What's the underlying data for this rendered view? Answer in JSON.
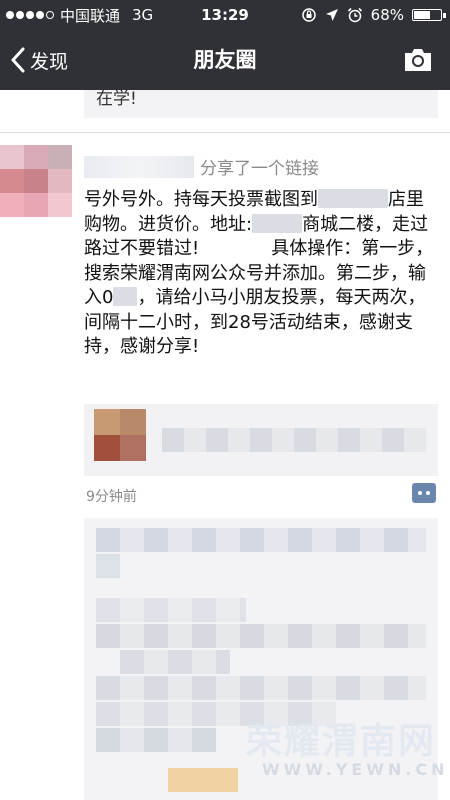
{
  "status_bar": {
    "carrier": "中国联通",
    "network": "3G",
    "time": "13:29",
    "battery": "68%",
    "battery_level": 0.68,
    "signal_bars": 4
  },
  "nav": {
    "back_label": "发现",
    "title": "朋友圈"
  },
  "previous_post": {
    "comment_fragment": "在学!"
  },
  "post": {
    "shared_label": "分享了一个链接",
    "text_segments": [
      "号外号外。持每天投票截图到",
      "店里购物。进货价。地址:",
      "商城二楼，走过路过不要错过!　　　　具体操作：第一步，搜索荣耀渭南网公众号并添加。第二步，输入0",
      "，请给小马小朋友投票，每天两次，间隔十二小时，到28号活动结束，感谢支持，感谢分享!"
    ],
    "timestamp": "9分钟前"
  },
  "watermark": {
    "text": "荣耀渭南网",
    "url": "WWW.YEWN.CN"
  },
  "colors": {
    "bar_bg": "#2f3136",
    "timestamp": "#8a8a8a",
    "comment_button": "#6a86ad",
    "comments_bg": "#f3f3f5"
  },
  "icons": {
    "back": "chevron-left-icon",
    "camera": "camera-icon",
    "comment": "comment-icon"
  }
}
